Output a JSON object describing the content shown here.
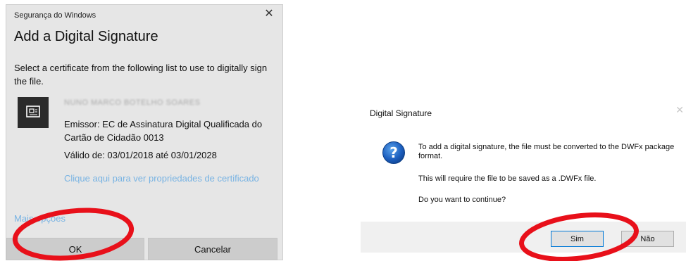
{
  "security_dialog": {
    "caption": "Segurança do Windows",
    "close_glyph": "✕",
    "title": "Add a Digital Signature",
    "instruction": "Select a certificate from the following list to use to digitally sign the file.",
    "certificate": {
      "icon": "certificate-icon",
      "name": "NUNO MARCO BOTELHO SOARES",
      "issuer": "Emissor: EC de Assinatura Digital Qualificada do Cartão de Cidadão 0013",
      "validity": "Válido de: 03/01/2018 até 03/01/2028",
      "properties_link": "Clique aqui para ver propriedades de certificado"
    },
    "more_options": "Mais opções",
    "ok_label": "OK",
    "cancel_label": "Cancelar",
    "colors": {
      "background": "#e6e6e6",
      "link": "#78b3e3",
      "button": "#cccccc"
    }
  },
  "digital_signature_dialog": {
    "title": "Digital Signature",
    "close_glyph": "✕",
    "icon": "question-icon",
    "message_line1": "To add a digital signature, the file must be converted to the DWFx package format.",
    "message_line2": "This will require the file to be saved as a .DWFx file.",
    "message_line3": "Do you want to continue?",
    "yes_label": "Sim",
    "no_label": "Não",
    "colors": {
      "footer": "#f0f0f0",
      "default_button_border": "#0078d7"
    }
  },
  "annotations": {
    "color": "#e8101a",
    "highlights": [
      "ok-button",
      "sim-button"
    ]
  }
}
